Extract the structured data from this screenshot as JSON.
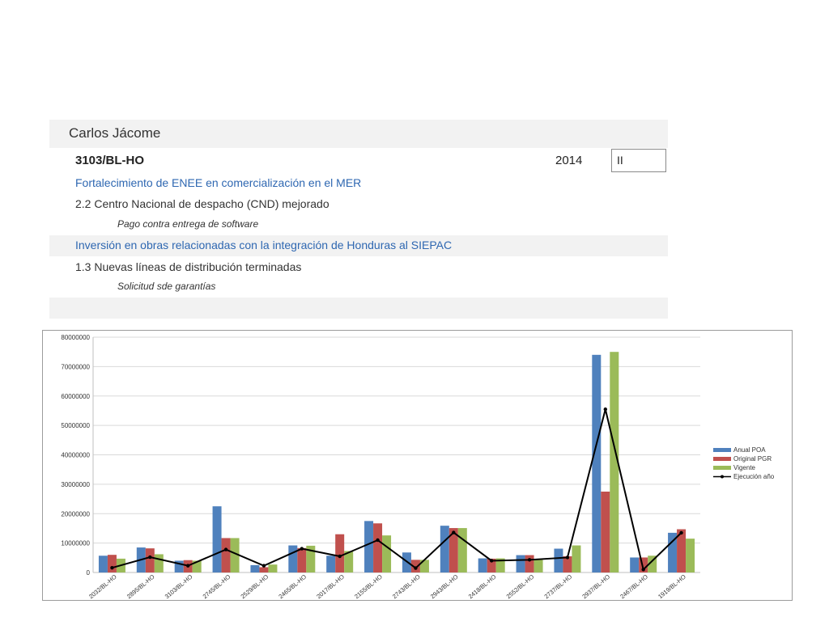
{
  "header": {
    "person": "Carlos Jácome",
    "code": "3103/BL-HO",
    "year": "2014",
    "quarter": "II"
  },
  "projects": [
    {
      "title": "Fortalecimiento de ENEE en comercialización en el MER",
      "item": "2.2 Centro Nacional de despacho (CND) mejorado",
      "sub": "Pago contra entrega de software"
    },
    {
      "title": "Inversión en obras relacionadas con la integración de Honduras al SIEPAC",
      "item": "1.3 Nuevas líneas de distribución terminadas",
      "sub": "Solicitud sde garantías"
    }
  ],
  "colors": {
    "band": "#f2f2f2",
    "link_blue": "#2e67b1",
    "series": [
      "#4f81bd",
      "#c0504d",
      "#9bbb59",
      "#000000"
    ]
  },
  "chart_data": {
    "type": "bar",
    "categories": [
      "2032/BL-HO",
      "2895/BL-HO",
      "3103/BL-HO",
      "2745/BL-HO",
      "2529/BL-HO",
      "2465/BL-HO",
      "2017/BL-HO",
      "2155/BL-HO",
      "2743/BL-HO",
      "2943/BL-HO",
      "2418/BL-HO",
      "2552/BL-HO",
      "2737/BL-HO",
      "2937/BL-HO",
      "2467/BL-HO",
      "1919/BL-HO"
    ],
    "series": [
      {
        "name": "Anual POA",
        "type": "bar",
        "values": [
          5700000,
          8500000,
          4000000,
          22500000,
          2500000,
          9200000,
          5700000,
          17500000,
          6800000,
          15900000,
          4800000,
          5900000,
          8100000,
          74000000,
          5100000,
          13500000
        ]
      },
      {
        "name": "Original PGR",
        "type": "bar",
        "values": [
          6000000,
          8200000,
          4200000,
          11700000,
          1800000,
          8300000,
          13000000,
          16700000,
          4300000,
          15100000,
          4700000,
          5900000,
          5500000,
          27500000,
          5100000,
          14700000
        ]
      },
      {
        "name": "Vigente",
        "type": "bar",
        "values": [
          4700000,
          6200000,
          4000000,
          11700000,
          2700000,
          9100000,
          7300000,
          12600000,
          4300000,
          15100000,
          4800000,
          4300000,
          9200000,
          75000000,
          5700000,
          11500000
        ]
      },
      {
        "name": "Ejecución año",
        "type": "line",
        "values": [
          1600000,
          5200000,
          2300000,
          7800000,
          2300000,
          8100000,
          5500000,
          11000000,
          1500000,
          13600000,
          4000000,
          4300000,
          5100000,
          55500000,
          1000000,
          13500000
        ]
      }
    ],
    "y_ticks": [
      "0",
      "10000000",
      "20000000",
      "30000000",
      "40000000",
      "50000000",
      "60000000",
      "70000000",
      "80000000"
    ],
    "ylim": [
      0,
      80000000
    ],
    "grid": true,
    "legend_position": "right"
  }
}
